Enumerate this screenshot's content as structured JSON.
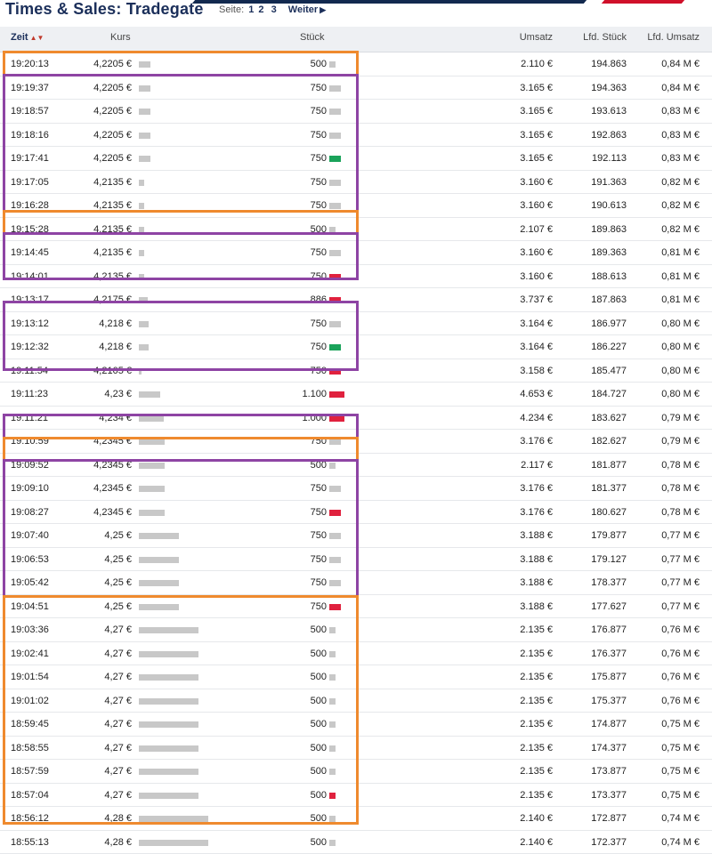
{
  "header": {
    "title": "Times & Sales: Tradegate",
    "pager_label": "Seite:",
    "pages": [
      "1",
      "2",
      "3"
    ],
    "next_label": "Weiter"
  },
  "columns": {
    "zeit": "Zeit",
    "kurs": "Kurs",
    "stueck": "Stück",
    "umsatz": "Umsatz",
    "lfd_stueck": "Lfd. Stück",
    "lfd_umsatz": "Lfd. Umsatz"
  },
  "colors": {
    "up": "#1aa35a",
    "down": "#e0213e",
    "neutral": "#c8c8c8",
    "highlight_orange": "#ef8a2e",
    "highlight_purple": "#8e44a4"
  },
  "rows": [
    {
      "time": "19:20:13",
      "price": "4,2205 €",
      "price_val": 4.2205,
      "qty": "500",
      "qty_val": 500,
      "dir": "neutral",
      "umsatz": "2.110 €",
      "lfd_stueck": "194.863",
      "lfd_umsatz": "0,84 M €"
    },
    {
      "time": "19:19:37",
      "price": "4,2205 €",
      "price_val": 4.2205,
      "qty": "750",
      "qty_val": 750,
      "dir": "neutral",
      "umsatz": "3.165 €",
      "lfd_stueck": "194.363",
      "lfd_umsatz": "0,84 M €"
    },
    {
      "time": "19:18:57",
      "price": "4,2205 €",
      "price_val": 4.2205,
      "qty": "750",
      "qty_val": 750,
      "dir": "neutral",
      "umsatz": "3.165 €",
      "lfd_stueck": "193.613",
      "lfd_umsatz": "0,83 M €"
    },
    {
      "time": "19:18:16",
      "price": "4,2205 €",
      "price_val": 4.2205,
      "qty": "750",
      "qty_val": 750,
      "dir": "neutral",
      "umsatz": "3.165 €",
      "lfd_stueck": "192.863",
      "lfd_umsatz": "0,83 M €"
    },
    {
      "time": "19:17:41",
      "price": "4,2205 €",
      "price_val": 4.2205,
      "qty": "750",
      "qty_val": 750,
      "dir": "up",
      "umsatz": "3.165 €",
      "lfd_stueck": "192.113",
      "lfd_umsatz": "0,83 M €"
    },
    {
      "time": "19:17:05",
      "price": "4,2135 €",
      "price_val": 4.2135,
      "qty": "750",
      "qty_val": 750,
      "dir": "neutral",
      "umsatz": "3.160 €",
      "lfd_stueck": "191.363",
      "lfd_umsatz": "0,82 M €"
    },
    {
      "time": "19:16:28",
      "price": "4,2135 €",
      "price_val": 4.2135,
      "qty": "750",
      "qty_val": 750,
      "dir": "neutral",
      "umsatz": "3.160 €",
      "lfd_stueck": "190.613",
      "lfd_umsatz": "0,82 M €"
    },
    {
      "time": "19:15:28",
      "price": "4,2135 €",
      "price_val": 4.2135,
      "qty": "500",
      "qty_val": 500,
      "dir": "neutral",
      "umsatz": "2.107 €",
      "lfd_stueck": "189.863",
      "lfd_umsatz": "0,82 M €"
    },
    {
      "time": "19:14:45",
      "price": "4,2135 €",
      "price_val": 4.2135,
      "qty": "750",
      "qty_val": 750,
      "dir": "neutral",
      "umsatz": "3.160 €",
      "lfd_stueck": "189.363",
      "lfd_umsatz": "0,81 M €"
    },
    {
      "time": "19:14:01",
      "price": "4,2135 €",
      "price_val": 4.2135,
      "qty": "750",
      "qty_val": 750,
      "dir": "down",
      "umsatz": "3.160 €",
      "lfd_stueck": "188.613",
      "lfd_umsatz": "0,81 M €"
    },
    {
      "time": "19:13:17",
      "price": "4,2175 €",
      "price_val": 4.2175,
      "qty": "886",
      "qty_val": 886,
      "dir": "down",
      "umsatz": "3.737 €",
      "lfd_stueck": "187.863",
      "lfd_umsatz": "0,81 M €"
    },
    {
      "time": "19:13:12",
      "price": "4,218 €",
      "price_val": 4.218,
      "qty": "750",
      "qty_val": 750,
      "dir": "neutral",
      "umsatz": "3.164 €",
      "lfd_stueck": "186.977",
      "lfd_umsatz": "0,80 M €"
    },
    {
      "time": "19:12:32",
      "price": "4,218 €",
      "price_val": 4.218,
      "qty": "750",
      "qty_val": 750,
      "dir": "up",
      "umsatz": "3.164 €",
      "lfd_stueck": "186.227",
      "lfd_umsatz": "0,80 M €"
    },
    {
      "time": "19:11:54",
      "price": "4,2105 €",
      "price_val": 4.2105,
      "qty": "750",
      "qty_val": 750,
      "dir": "down",
      "umsatz": "3.158 €",
      "lfd_stueck": "185.477",
      "lfd_umsatz": "0,80 M €"
    },
    {
      "time": "19:11:23",
      "price": "4,23 €",
      "price_val": 4.23,
      "qty": "1.100",
      "qty_val": 1100,
      "dir": "down",
      "umsatz": "4.653 €",
      "lfd_stueck": "184.727",
      "lfd_umsatz": "0,80 M €"
    },
    {
      "time": "19:11:21",
      "price": "4,234 €",
      "price_val": 4.234,
      "qty": "1.000",
      "qty_val": 1000,
      "dir": "down",
      "umsatz": "4.234 €",
      "lfd_stueck": "183.627",
      "lfd_umsatz": "0,79 M €"
    },
    {
      "time": "19:10:59",
      "price": "4,2345 €",
      "price_val": 4.2345,
      "qty": "750",
      "qty_val": 750,
      "dir": "neutral",
      "umsatz": "3.176 €",
      "lfd_stueck": "182.627",
      "lfd_umsatz": "0,79 M €"
    },
    {
      "time": "19:09:52",
      "price": "4,2345 €",
      "price_val": 4.2345,
      "qty": "500",
      "qty_val": 500,
      "dir": "neutral",
      "umsatz": "2.117 €",
      "lfd_stueck": "181.877",
      "lfd_umsatz": "0,78 M €"
    },
    {
      "time": "19:09:10",
      "price": "4,2345 €",
      "price_val": 4.2345,
      "qty": "750",
      "qty_val": 750,
      "dir": "neutral",
      "umsatz": "3.176 €",
      "lfd_stueck": "181.377",
      "lfd_umsatz": "0,78 M €"
    },
    {
      "time": "19:08:27",
      "price": "4,2345 €",
      "price_val": 4.2345,
      "qty": "750",
      "qty_val": 750,
      "dir": "down",
      "umsatz": "3.176 €",
      "lfd_stueck": "180.627",
      "lfd_umsatz": "0,78 M €"
    },
    {
      "time": "19:07:40",
      "price": "4,25 €",
      "price_val": 4.25,
      "qty": "750",
      "qty_val": 750,
      "dir": "neutral",
      "umsatz": "3.188 €",
      "lfd_stueck": "179.877",
      "lfd_umsatz": "0,77 M €"
    },
    {
      "time": "19:06:53",
      "price": "4,25 €",
      "price_val": 4.25,
      "qty": "750",
      "qty_val": 750,
      "dir": "neutral",
      "umsatz": "3.188 €",
      "lfd_stueck": "179.127",
      "lfd_umsatz": "0,77 M €"
    },
    {
      "time": "19:05:42",
      "price": "4,25 €",
      "price_val": 4.25,
      "qty": "750",
      "qty_val": 750,
      "dir": "neutral",
      "umsatz": "3.188 €",
      "lfd_stueck": "178.377",
      "lfd_umsatz": "0,77 M €"
    },
    {
      "time": "19:04:51",
      "price": "4,25 €",
      "price_val": 4.25,
      "qty": "750",
      "qty_val": 750,
      "dir": "down",
      "umsatz": "3.188 €",
      "lfd_stueck": "177.627",
      "lfd_umsatz": "0,77 M €"
    },
    {
      "time": "19:03:36",
      "price": "4,27 €",
      "price_val": 4.27,
      "qty": "500",
      "qty_val": 500,
      "dir": "neutral",
      "umsatz": "2.135 €",
      "lfd_stueck": "176.877",
      "lfd_umsatz": "0,76 M €"
    },
    {
      "time": "19:02:41",
      "price": "4,27 €",
      "price_val": 4.27,
      "qty": "500",
      "qty_val": 500,
      "dir": "neutral",
      "umsatz": "2.135 €",
      "lfd_stueck": "176.377",
      "lfd_umsatz": "0,76 M €"
    },
    {
      "time": "19:01:54",
      "price": "4,27 €",
      "price_val": 4.27,
      "qty": "500",
      "qty_val": 500,
      "dir": "neutral",
      "umsatz": "2.135 €",
      "lfd_stueck": "175.877",
      "lfd_umsatz": "0,76 M €"
    },
    {
      "time": "19:01:02",
      "price": "4,27 €",
      "price_val": 4.27,
      "qty": "500",
      "qty_val": 500,
      "dir": "neutral",
      "umsatz": "2.135 €",
      "lfd_stueck": "175.377",
      "lfd_umsatz": "0,76 M €"
    },
    {
      "time": "18:59:45",
      "price": "4,27 €",
      "price_val": 4.27,
      "qty": "500",
      "qty_val": 500,
      "dir": "neutral",
      "umsatz": "2.135 €",
      "lfd_stueck": "174.877",
      "lfd_umsatz": "0,75 M €"
    },
    {
      "time": "18:58:55",
      "price": "4,27 €",
      "price_val": 4.27,
      "qty": "500",
      "qty_val": 500,
      "dir": "neutral",
      "umsatz": "2.135 €",
      "lfd_stueck": "174.377",
      "lfd_umsatz": "0,75 M €"
    },
    {
      "time": "18:57:59",
      "price": "4,27 €",
      "price_val": 4.27,
      "qty": "500",
      "qty_val": 500,
      "dir": "neutral",
      "umsatz": "2.135 €",
      "lfd_stueck": "173.877",
      "lfd_umsatz": "0,75 M €"
    },
    {
      "time": "18:57:04",
      "price": "4,27 €",
      "price_val": 4.27,
      "qty": "500",
      "qty_val": 500,
      "dir": "down",
      "umsatz": "2.135 €",
      "lfd_stueck": "173.377",
      "lfd_umsatz": "0,75 M €"
    },
    {
      "time": "18:56:12",
      "price": "4,28 €",
      "price_val": 4.28,
      "qty": "500",
      "qty_val": 500,
      "dir": "neutral",
      "umsatz": "2.140 €",
      "lfd_stueck": "172.877",
      "lfd_umsatz": "0,74 M €"
    },
    {
      "time": "18:55:13",
      "price": "4,28 €",
      "price_val": 4.28,
      "qty": "500",
      "qty_val": 500,
      "dir": "neutral",
      "umsatz": "2.140 €",
      "lfd_stueck": "172.377",
      "lfd_umsatz": "0,74 M €"
    }
  ],
  "highlights": [
    {
      "color": "orange",
      "from": 0,
      "to": 0
    },
    {
      "color": "purple",
      "from": 1,
      "to": 6
    },
    {
      "color": "orange",
      "from": 7,
      "to": 7
    },
    {
      "color": "purple",
      "from": 8,
      "to": 9
    },
    {
      "color": "purple",
      "from": 11,
      "to": 13
    },
    {
      "color": "purple",
      "from": 16,
      "to": 16
    },
    {
      "color": "orange",
      "from": 17,
      "to": 17
    },
    {
      "color": "purple",
      "from": 18,
      "to": 23
    },
    {
      "color": "orange",
      "from": 24,
      "to": 33
    }
  ]
}
